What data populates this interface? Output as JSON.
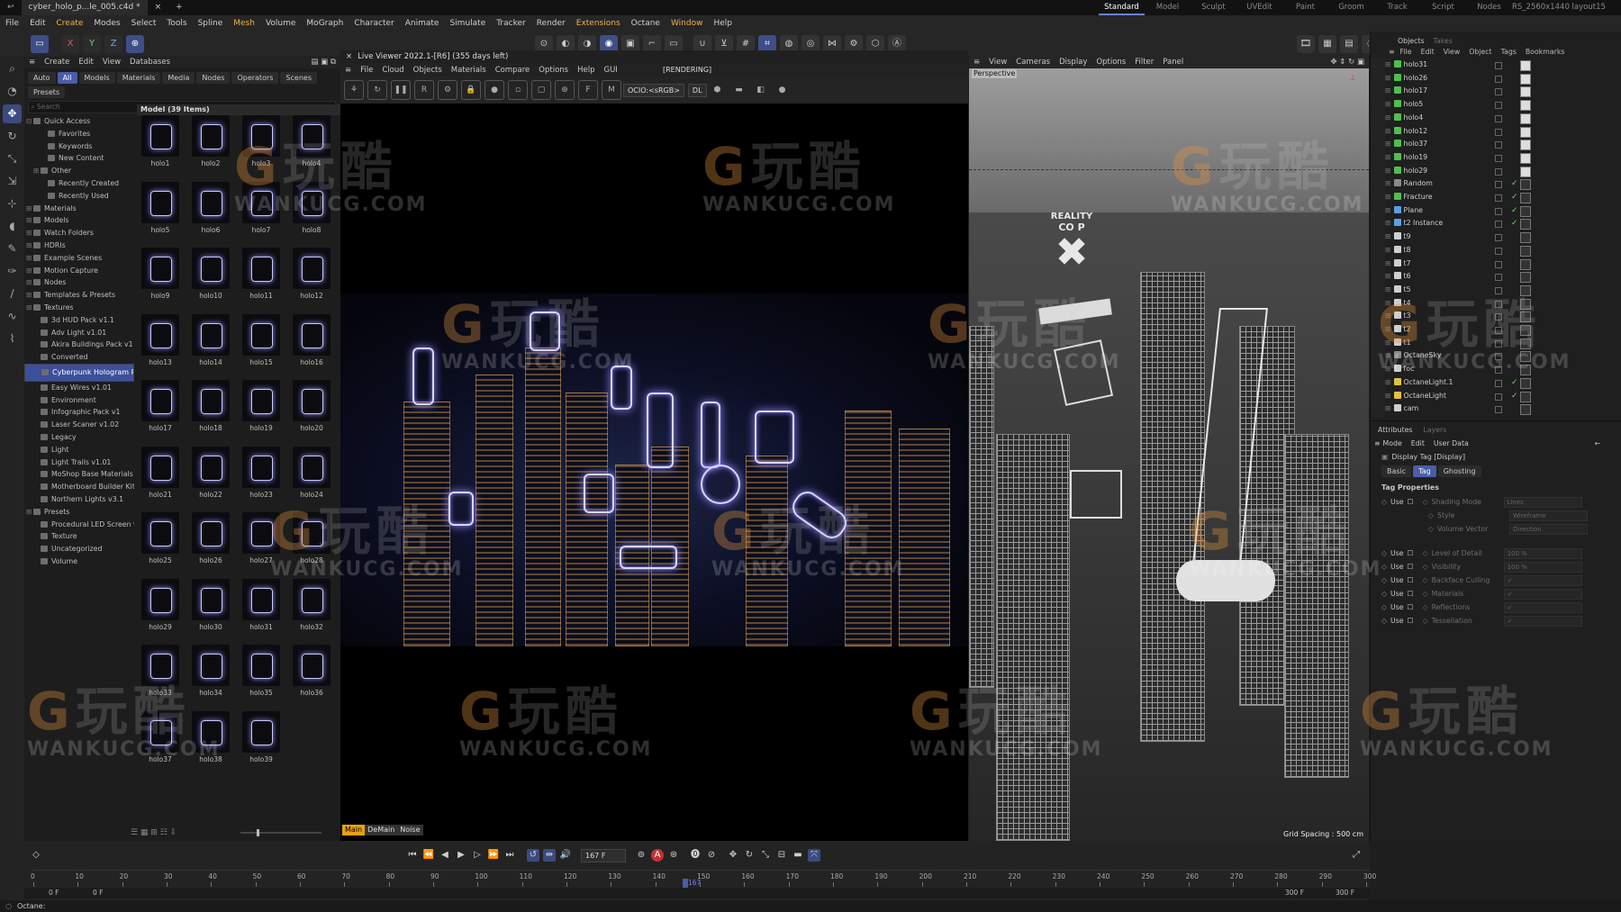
{
  "titlebar": {
    "file_tab": "cyber_holo_p...le_005.c4d *",
    "new_tab": "+",
    "layouts": [
      "Standard",
      "Model",
      "Sculpt",
      "UVEdit",
      "Paint",
      "Groom",
      "Track",
      "Script",
      "Nodes",
      "RS_2560x1440 layout15"
    ],
    "active_layout": "Standard"
  },
  "menubar": [
    "File",
    "Edit",
    "Create",
    "Modes",
    "Select",
    "Tools",
    "Spline",
    "Mesh",
    "Volume",
    "MoGraph",
    "Character",
    "Animate",
    "Simulate",
    "Tracker",
    "Render",
    "Extensions",
    "Octane",
    "Window",
    "Help"
  ],
  "toolbar": {
    "x": "X",
    "y": "Y",
    "z": "Z"
  },
  "browser": {
    "menu": [
      "Create",
      "Edit",
      "View",
      "Databases"
    ],
    "filters": [
      "Auto",
      "All",
      "Models",
      "Materials",
      "Media",
      "Nodes",
      "Operators",
      "Scenes"
    ],
    "active_filter": "All",
    "presets": "Presets",
    "search_placeholder": "Search",
    "grid_header": "Model (39 Items)",
    "tree": [
      {
        "label": "Quick Access",
        "exp": "⊟"
      },
      {
        "label": "Favorites",
        "ind": 2
      },
      {
        "label": "Keywords",
        "ind": 2
      },
      {
        "label": "New Content",
        "ind": 2
      },
      {
        "label": "Other",
        "ind": 1,
        "exp": "⊞"
      },
      {
        "label": "Recently Created",
        "ind": 2
      },
      {
        "label": "Recently Used",
        "ind": 2
      },
      {
        "label": "Materials",
        "exp": "⊞"
      },
      {
        "label": "Models",
        "exp": "⊞"
      },
      {
        "label": "Watch Folders",
        "exp": "⊞"
      },
      {
        "label": "HDRIs",
        "exp": "⊞"
      },
      {
        "label": "Example Scenes",
        "exp": "⊞"
      },
      {
        "label": "Motion Capture",
        "exp": "⊞"
      },
      {
        "label": "Nodes",
        "exp": "⊞"
      },
      {
        "label": "Templates & Presets",
        "exp": "⊞"
      },
      {
        "label": "Textures",
        "exp": "⊞"
      },
      {
        "label": "3d HUD Pack v1.1",
        "ind": 1
      },
      {
        "label": "Adv Light v1.01",
        "ind": 1
      },
      {
        "label": "Akira Buildings Pack v1",
        "ind": 1
      },
      {
        "label": "Converted",
        "ind": 1
      },
      {
        "label": "Cyberpunk Hologram Pa",
        "ind": 1,
        "sel": true
      },
      {
        "label": "Easy Wires v1.01",
        "ind": 1
      },
      {
        "label": "Environment",
        "ind": 1
      },
      {
        "label": "Infographic Pack v1",
        "ind": 1
      },
      {
        "label": "Laser Scaner v1.02",
        "ind": 1
      },
      {
        "label": "Legacy",
        "ind": 1
      },
      {
        "label": "Light",
        "ind": 1
      },
      {
        "label": "Light Trails v1.01",
        "ind": 1
      },
      {
        "label": "MoShop Base Materials",
        "ind": 1
      },
      {
        "label": "Motherboard Builder Kit",
        "ind": 1
      },
      {
        "label": "Northern Lights v3.1",
        "ind": 1
      },
      {
        "label": "Presets",
        "exp": "⊞"
      },
      {
        "label": "Procedural LED Screen v",
        "ind": 1
      },
      {
        "label": "Texture",
        "ind": 1
      },
      {
        "label": "Uncategorized",
        "ind": 1
      },
      {
        "label": "Volume",
        "ind": 1
      }
    ],
    "items": [
      "holo1",
      "holo2",
      "holo3",
      "holo4",
      "holo5",
      "holo6",
      "holo7",
      "holo8",
      "holo9",
      "holo10",
      "holo11",
      "holo12",
      "holo13",
      "holo14",
      "holo15",
      "holo16",
      "holo17",
      "holo18",
      "holo19",
      "holo20",
      "holo21",
      "holo22",
      "holo23",
      "holo24",
      "holo25",
      "holo26",
      "holo27",
      "holo28",
      "holo29",
      "holo30",
      "holo31",
      "holo32",
      "holo33",
      "holo34",
      "holo35",
      "holo36",
      "holo37",
      "holo38",
      "holo39"
    ]
  },
  "live_viewer": {
    "title": "Live Viewer 2022.1-[R6] (355 days left)",
    "menu": [
      "File",
      "Cloud",
      "Objects",
      "Materials",
      "Compare",
      "Options",
      "Help",
      "GUI"
    ],
    "status": "[RENDERING]",
    "ocio": "OCIO:<sRGB>",
    "dl": "DL",
    "pass_tabs": [
      "Main",
      "DeMain",
      "Noise"
    ],
    "active_pass": "Main"
  },
  "viewport": {
    "menu": [
      "View",
      "Cameras",
      "Display",
      "Options",
      "Filter",
      "Panel"
    ],
    "label": "Perspective",
    "grid_spacing": "Grid Spacing : 500 cm",
    "sign_top": "REALITY",
    "sign_bottom": "CO P"
  },
  "objects": {
    "tabs": [
      "Objects",
      "Takes"
    ],
    "active_tab": "Objects",
    "menu": [
      "File",
      "Edit",
      "View",
      "Object",
      "Tags",
      "Bookmarks"
    ],
    "rows": [
      {
        "name": "holo31",
        "color": "#4fbf4f"
      },
      {
        "name": "holo26",
        "color": "#4fbf4f"
      },
      {
        "name": "holo17",
        "color": "#4fbf4f"
      },
      {
        "name": "holo5",
        "color": "#4fbf4f"
      },
      {
        "name": "holo4",
        "color": "#4fbf4f"
      },
      {
        "name": "holo12",
        "color": "#4fbf4f"
      },
      {
        "name": "holo37",
        "color": "#4fbf4f"
      },
      {
        "name": "holo19",
        "color": "#4fbf4f"
      },
      {
        "name": "holo29",
        "color": "#4fbf4f"
      },
      {
        "name": "Random",
        "color": "#8a8a8a"
      },
      {
        "name": "Fracture",
        "color": "#4fbf4f"
      },
      {
        "name": "Plane",
        "color": "#5aa0e6"
      },
      {
        "name": "t2 Instance",
        "color": "#5aa0e6"
      },
      {
        "name": "t9",
        "color": "#cfcfcf"
      },
      {
        "name": "t8",
        "color": "#cfcfcf"
      },
      {
        "name": "t7",
        "color": "#cfcfcf"
      },
      {
        "name": "t6",
        "color": "#cfcfcf"
      },
      {
        "name": "t5",
        "color": "#cfcfcf"
      },
      {
        "name": "t4",
        "color": "#cfcfcf"
      },
      {
        "name": "t3",
        "color": "#cfcfcf"
      },
      {
        "name": "t2",
        "color": "#cfcfcf"
      },
      {
        "name": "t1",
        "color": "#cfcfcf"
      },
      {
        "name": "OctaneSky",
        "color": "#8a8a8a"
      },
      {
        "name": "foc",
        "color": "#cfcfcf"
      },
      {
        "name": "OctaneLight.1",
        "color": "#e2c14a"
      },
      {
        "name": "OctaneLight",
        "color": "#e2c14a"
      },
      {
        "name": "cam",
        "color": "#cfcfcf"
      }
    ]
  },
  "attributes": {
    "tabs": [
      "Attributes",
      "Layers"
    ],
    "menu": [
      "Mode",
      "Edit",
      "User Data"
    ],
    "tag_title": "Display Tag [Display]",
    "subtabs": [
      "Basic",
      "Tag",
      "Ghosting"
    ],
    "active_subtab": "Tag",
    "section": "Tag Properties",
    "use": "Use",
    "props": [
      {
        "name": "Shading Mode",
        "value": "Lines",
        "use": true
      },
      {
        "name": "Style",
        "value": "Wireframe"
      },
      {
        "name": "Volume Vector",
        "value": "Direction"
      },
      {
        "name": "Level of Detail",
        "value": "100 %",
        "use": true
      },
      {
        "name": "Visibility",
        "value": "100 %",
        "use": true
      },
      {
        "name": "Backface Culling",
        "value": "✓",
        "use": true
      },
      {
        "name": "Materials",
        "value": "✓",
        "use": true
      },
      {
        "name": "Reflections",
        "value": "✓",
        "use": true
      },
      {
        "name": "Tessellation",
        "value": "✓",
        "use": true
      }
    ]
  },
  "timeline": {
    "frame": "167 F",
    "start": "0 F",
    "start2": "0 F",
    "end": "300 F",
    "end2": "300 F",
    "current_label": "167",
    "ticks": [
      "0",
      "10",
      "20",
      "30",
      "40",
      "50",
      "60",
      "70",
      "80",
      "90",
      "100",
      "110",
      "120",
      "130",
      "140",
      "150",
      "160",
      "170",
      "180",
      "190",
      "200",
      "210",
      "220",
      "230",
      "240",
      "250",
      "260",
      "270",
      "280",
      "290",
      "300"
    ]
  },
  "status": {
    "text": "Octane:"
  },
  "watermark": {
    "text": "WANKUCG.COM",
    "zh": "玩酷"
  }
}
